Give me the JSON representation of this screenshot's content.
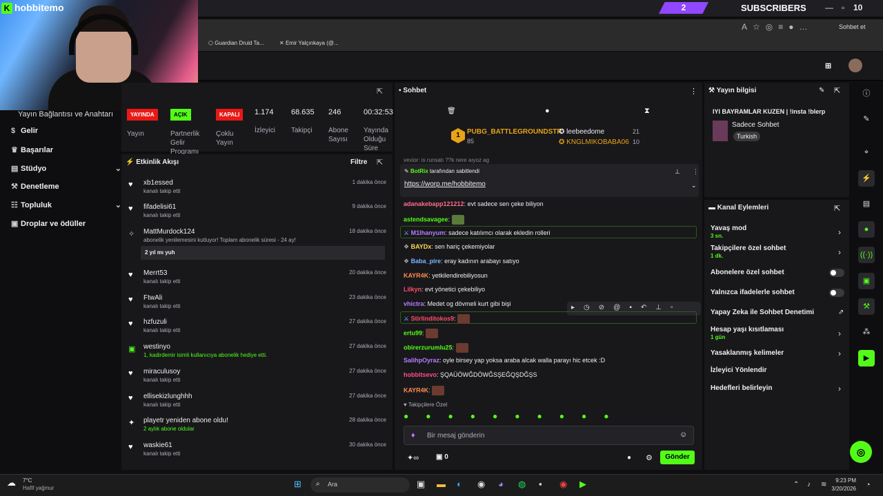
{
  "top": {
    "subs_count": "2",
    "subs_label": "SUBSCRIBERS",
    "counter": "10",
    "sohbet_et": "Sohbet et"
  },
  "bookmarks": [
    "Guardian Druid Ta...",
    "Emir Yalçınkaya (@..."
  ],
  "logo": "hobbitemo",
  "sidebar": {
    "title": "Yayın Bağlantısı ve Anahtarı",
    "items": [
      {
        "label": "Gelir",
        "icon": "dollar-icon"
      },
      {
        "label": "Başarılar",
        "icon": "trophy-icon"
      },
      {
        "label": "Stüdyo",
        "icon": "studio-icon"
      },
      {
        "label": "Denetleme",
        "icon": "wrench-icon"
      },
      {
        "label": "Topluluk",
        "icon": "users-icon"
      },
      {
        "label": "Droplar ve ödüller",
        "icon": "gift-icon"
      }
    ]
  },
  "stream": {
    "yayin_badge": "YAYINDA",
    "yayin": "Yayın",
    "acik_badge": "AÇIK",
    "partner": "Partnerlik Gelir Programı",
    "kapali_badge": "KAPALI",
    "coklu": "Çoklu Yayın",
    "izleyici_v": "1.174",
    "izleyici": "İzleyici",
    "takipci_v": "68.635",
    "takipci": "Takipçi",
    "abone_v": "246",
    "abone": "Abone Sayısı",
    "sure_v": "00:32:53",
    "sure": "Yayında Olduğu Süre"
  },
  "activity": {
    "title": "Etkinlik Akışı",
    "filter": "Filtre",
    "items": [
      {
        "name": "xb1essed",
        "sub": "kanalı takip etti",
        "time": "1 dakika önce"
      },
      {
        "name": "fifadelisi61",
        "sub": "kanalı takip etti",
        "time": "9 dakika önce"
      },
      {
        "name": "MattMurdock124",
        "sub": "abonelik yenilemesini kutluyor! Toplam abonelik süresi - 24 ay!",
        "time": "18 dakika önce",
        "extra": "2 yıl mı yuh"
      },
      {
        "name": "Merrt53",
        "sub": "kanalı takip etti",
        "time": "20 dakika önce"
      },
      {
        "name": "FtwAli",
        "sub": "kanalı takip etti",
        "time": "23 dakika önce"
      },
      {
        "name": "hzfuzuli",
        "sub": "kanalı takip etti",
        "time": "27 dakika önce"
      },
      {
        "name": "westinyo",
        "sub": "1, kadirdemir isimli kullanıcıya abonelik hediye etti.",
        "time": "27 dakika önce"
      },
      {
        "name": "miraculusoy",
        "sub": "kanalı takip etti",
        "time": "27 dakika önce"
      },
      {
        "name": "ellisekizlunghhh",
        "sub": "kanalı takip etti",
        "time": "27 dakika önce"
      },
      {
        "name": "playetr yeniden abone oldu!",
        "sub": "2 aylık abone oldular",
        "time": "28 dakika önce"
      },
      {
        "name": "waskie61",
        "sub": "kanalı takip etti",
        "time": "30 dakika önce"
      }
    ]
  },
  "chat": {
    "title": "Sohbet",
    "leader1": "PUBG_BATTLEGROUNDSTR",
    "leader1_n": "85",
    "leader2": "leebeedome",
    "leader2_n": "21",
    "leader3": "KNGLMIKOBABA06",
    "leader3_n": "10",
    "pinned_by": "BotRix",
    "pinned_suffix": "tarafından sabitlendi",
    "pinned_link": "https://worp.me/hobbitemo",
    "top_partial": "vexior: is runsatı ??k nere aıyoz ag",
    "lines": [
      {
        "user": "adanakebapp121212",
        "color": "#ff6b8b",
        "text": ": evt sadece sen çeke biliyon"
      },
      {
        "user": "astendsavagee",
        "color": "#53fc18",
        "text": ":"
      },
      {
        "user": "M1lhanyum",
        "color": "#b57cff",
        "text": ": sadece katılımcı olarak ekledin rolleri"
      },
      {
        "user": "BAYDx",
        "color": "#ffd84c",
        "text": ": sen hariç çekemiyolar"
      },
      {
        "user": "Baba_pire",
        "color": "#7ab6ff",
        "text": ": eray kadının arabayı satıyo"
      },
      {
        "user": "KAYR4K",
        "color": "#ff8c4c",
        "text": ": yetkilendirebiliyosun"
      },
      {
        "user": "Lilkyn",
        "color": "#ff4c6b",
        "text": ": evt yönetici çekebiliyo"
      },
      {
        "user": "vhictra",
        "color": "#b57cff",
        "text": ": Medet og dövmeli kurt gibi bişi"
      },
      {
        "user": "Stirlinditokos9",
        "color": "#ff4c6b",
        "text": ":"
      },
      {
        "user": "ertu99",
        "color": "#53fc18",
        "text": ":"
      },
      {
        "user": "obirerzurumlu25",
        "color": "#53fc18",
        "text": ":"
      },
      {
        "user": "SalihpOyraz",
        "color": "#b57cff",
        "text": ": oyle birsey yap yoksa araba alcak walla parayı hic etcek :D"
      },
      {
        "user": "hobbitsevo",
        "color": "#ff4c8b",
        "text": ": ŞQAÜÖWĞDÖWĞSŞEĞQŞDĞŞS"
      },
      {
        "user": "KAYR4K",
        "color": "#ff8c4c",
        "text": ":"
      }
    ],
    "followers_only": "Takipçilere Özel",
    "placeholder": "Bir mesaj gönderin",
    "send": "Gönder",
    "count": "0"
  },
  "right": {
    "title": "Yayın bilgisi",
    "stream_title": "IYI BAYRAMLAR KUZEN | !insta !blerp",
    "category": "Sadece Sohbet",
    "lang": "Turkish",
    "actions_title": "Kanal Eylemleri",
    "opts": [
      {
        "label": "Yavaş mod",
        "sub": "3 sn."
      },
      {
        "label": "Takipçilere özel sohbet",
        "sub": "1 dk."
      },
      {
        "label": "Abonelere özel sohbet"
      },
      {
        "label": "Yalnızca ifadelerle sohbet"
      },
      {
        "label": "Yapay Zeka ile Sohbet Denetimi"
      },
      {
        "label": "Hesap yaşı kısıtlaması",
        "sub": "1 gün"
      },
      {
        "label": "Yasaklanmış kelimeler"
      },
      {
        "label": "İzleyici Yönlendir"
      },
      {
        "label": "Hedefleri belirleyin"
      }
    ]
  },
  "taskbar": {
    "temp": "7°C",
    "weather": "Hafif yağmur",
    "search": "Ara",
    "time": "9:23 PM",
    "date": "3/20/2026"
  },
  "colors": {
    "accent": "#53fc18",
    "live": "#e91916",
    "purple": "#9147ff"
  }
}
